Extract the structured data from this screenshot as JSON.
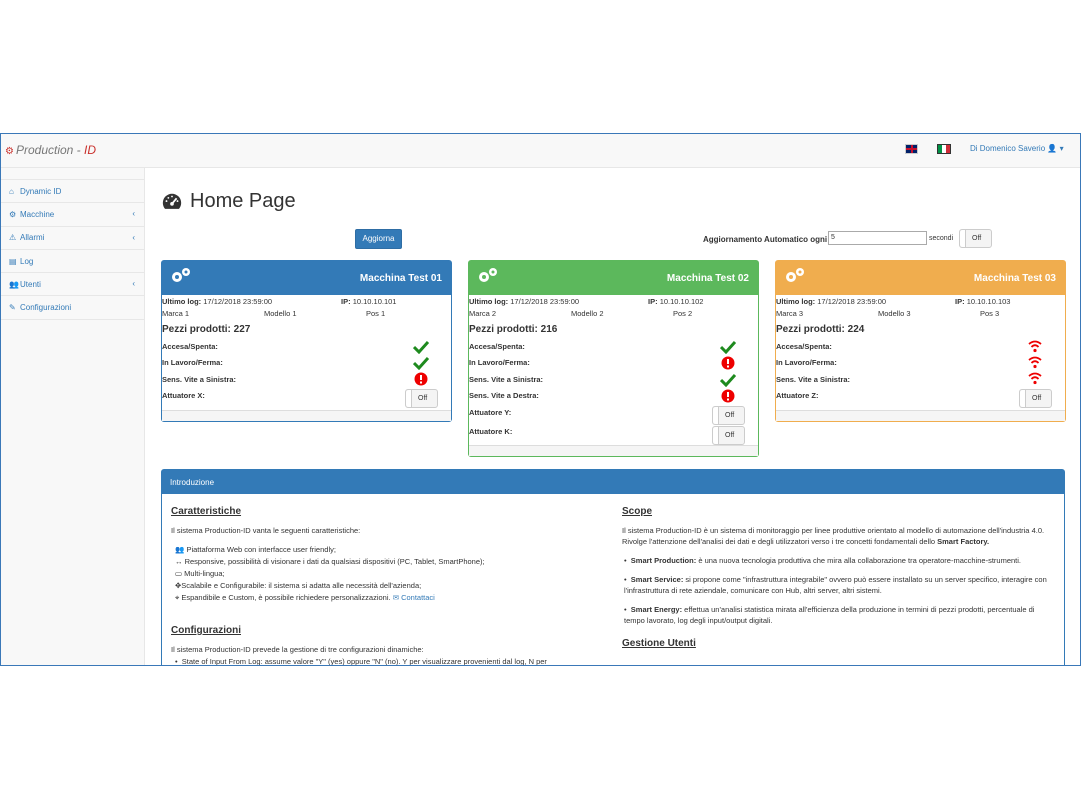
{
  "navbar": {
    "brand_part1": "Production - ",
    "brand_part2": "ID",
    "user_name": "Di Domenico Saverio"
  },
  "sidebar": {
    "items": [
      {
        "label": "Dynamic ID"
      },
      {
        "label": "Macchine"
      },
      {
        "label": "Allarmi"
      },
      {
        "label": "Log"
      },
      {
        "label": "Utenti"
      },
      {
        "label": "Configurazioni"
      }
    ]
  },
  "main": {
    "title": "Home Page",
    "update_button": "Aggiorna",
    "auto_update_label": "Aggiornamento Automatico ogni",
    "auto_update_value": "5",
    "auto_update_unit": "secondi",
    "toggle_off": "Off"
  },
  "machines": [
    {
      "name": "Macchina Test 01",
      "color": "#337ab7",
      "ultimo_log_label": "Ultimo log:",
      "ultimo_log": "17/12/2018 23:59:00",
      "ip_label": "IP:",
      "ip": "10.10.10.101",
      "marca": "Marca 1",
      "modello": "Modello 1",
      "pos": "Pos 1",
      "pezzi": "Pezzi prodotti: 227",
      "status": [
        {
          "label": "Accesa/Spenta:",
          "icon": "check-icon"
        },
        {
          "label": "In Lavoro/Ferma:",
          "icon": "check-icon"
        },
        {
          "label": "Sens. Vite a Sinistra:",
          "icon": "alert-icon"
        }
      ],
      "actuators": [
        {
          "label": "Attuatore X:",
          "state": "Off"
        }
      ]
    },
    {
      "name": "Macchina Test 02",
      "color": "#5cb85c",
      "ultimo_log_label": "Ultimo log:",
      "ultimo_log": "17/12/2018 23:59:00",
      "ip_label": "IP:",
      "ip": "10.10.10.102",
      "marca": "Marca 2",
      "modello": "Modello 2",
      "pos": "Pos 2",
      "pezzi": "Pezzi prodotti: 216",
      "status": [
        {
          "label": "Accesa/Spenta:",
          "icon": "check-icon"
        },
        {
          "label": "In Lavoro/Ferma:",
          "icon": "alert-icon"
        },
        {
          "label": "Sens. Vite a Sinistra:",
          "icon": "check-icon"
        },
        {
          "label": "Sens. Vite a Destra:",
          "icon": "alert-icon"
        }
      ],
      "actuators": [
        {
          "label": "Attuatore Y:",
          "state": "Off"
        },
        {
          "label": "Attuatore K:",
          "state": "Off"
        }
      ]
    },
    {
      "name": "Macchina Test 03",
      "color": "#f0ad4e",
      "ultimo_log_label": "Ultimo log:",
      "ultimo_log": "17/12/2018 23:59:00",
      "ip_label": "IP:",
      "ip": "10.10.10.103",
      "marca": "Marca 3",
      "modello": "Modello 3",
      "pos": "Pos 3",
      "pezzi": "Pezzi prodotti: 224",
      "status": [
        {
          "label": "Accesa/Spenta:",
          "icon": "wifi-icon"
        },
        {
          "label": "In Lavoro/Ferma:",
          "icon": "wifi-icon"
        },
        {
          "label": "Sens. Vite a Sinistra:",
          "icon": "wifi-icon"
        }
      ],
      "actuators": [
        {
          "label": "Attuatore Z:",
          "state": "Off"
        }
      ]
    }
  ],
  "intro": {
    "header": "Introduzione",
    "caratteristiche_title": "Caratteristiche",
    "caratteristiche_text": "Il sistema Production-ID vanta le seguenti caratteristiche:",
    "caratteristiche_items": [
      "Piattaforma Web con interfacce user friendly;",
      "Responsive, possibilità di visionare i dati da qualsiasi dispositivi (PC, Tablet, SmartPhone);",
      "Multi-lingua;",
      "Scalabile e Configurabile: il sistema si adatta alle necessità dell'azienda;",
      "Espandibile e Custom, è possibile richiedere personalizzazioni."
    ],
    "contact_link": "Contattaci",
    "configurazioni_title": "Configurazioni",
    "configurazioni_text": "Il sistema Production-ID prevede la gestione di tre configurazioni dinamiche:",
    "configurazioni_item": "State of Input From Log: assume valore \"Y\" (yes) oppure \"N\" (no). Y per visualizzare provenienti dal log, N per",
    "scope_title": "Scope",
    "scope_text": "Il sistema Production-ID è un sistema di monitoraggio per linee produttive orientato al modello di automazione dell'industria 4.0. Rivolge l'attenzione dell'analisi dei dati e degli utilizzatori verso i tre concetti fondamentali dello",
    "scope_bold": "Smart Factory.",
    "scope_items": [
      {
        "title": "Smart Production:",
        "text": "è una nuova tecnologia produttiva che mira alla collaborazione tra operatore-macchine-strumenti."
      },
      {
        "title": "Smart Service:",
        "text": "si propone come \"infrastruttura integrabile\" ovvero può essere installato su un server specifico, interagire con l'infrastruttura di rete aziendale, comunicare con Hub, altri server, altri sistemi."
      },
      {
        "title": "Smart Energy:",
        "text": "effettua un'analisi statistica mirata all'efficienza della produzione in termini di pezzi prodotti, percentuale di tempo lavorato, log degli input/output digitali."
      }
    ],
    "gestione_title": "Gestione Utenti"
  }
}
